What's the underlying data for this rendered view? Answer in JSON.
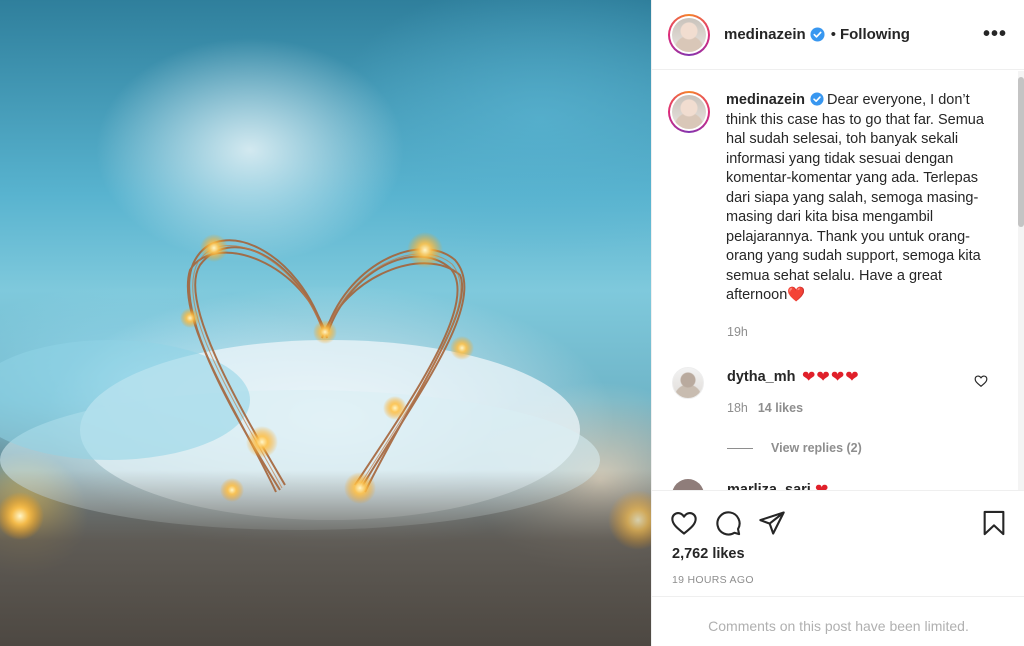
{
  "post": {
    "username": "medinazein",
    "separator": "•",
    "following_label": "Following",
    "more_label": "•••",
    "caption_username": "medinazein",
    "caption_text": "Dear everyone, I don’t think this case has to go that far. Semua hal sudah selesai, toh banyak sekali informasi yang tidak sesuai dengan komentar-komentar yang ada. Terlepas dari siapa yang salah, semoga masing-masing dari kita bisa mengambil pelajarannya. Thank you untuk orang-orang yang sudah support, semoga kita semua sehat selalu. Have a great afternoon",
    "caption_emoji": "❤️",
    "caption_time": "19h",
    "likes_text": "2,762 likes",
    "posted_ago": "19 HOURS AGO",
    "comments_limited": "Comments on this post have been limited."
  },
  "comments": [
    {
      "username": "dytha_mh",
      "text": "❤❤❤❤",
      "time": "18h",
      "likes": "14 likes",
      "replies_label": "View replies (2)"
    },
    {
      "username": "marliza_sari",
      "text": "❤"
    }
  ],
  "colors": {
    "text": "#262626",
    "muted": "#8e8e8e",
    "verified": "#3897f0",
    "heart": "#e0202a",
    "border": "#efefef"
  },
  "icons": [
    "verified-icon",
    "more-options-icon",
    "like-icon",
    "comment-icon",
    "share-icon",
    "save-icon",
    "comment-like-icon"
  ]
}
